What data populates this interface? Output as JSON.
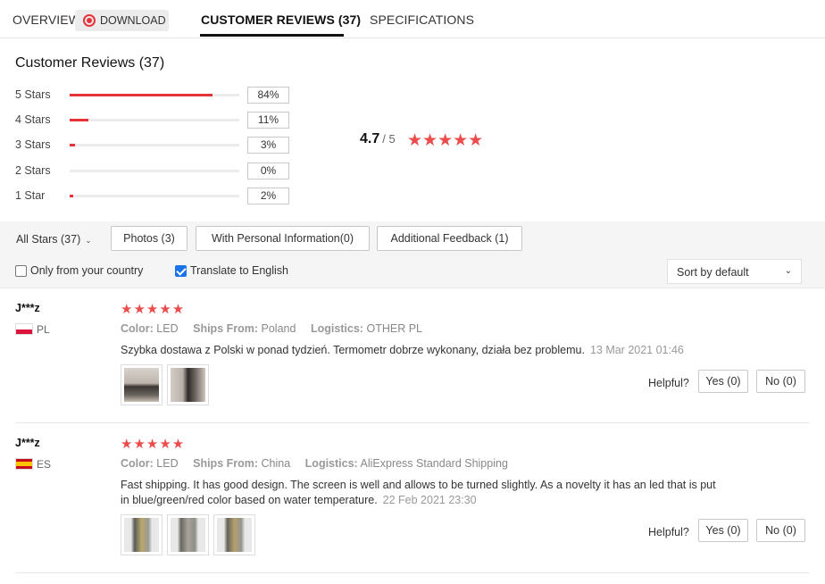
{
  "tabs": {
    "overview": "OVERVIEW",
    "download": "DOWNLOAD",
    "reviews": "CUSTOMER REVIEWS (37)",
    "specs": "SPECIFICATIONS"
  },
  "summary": {
    "title": "Customer Reviews (37)",
    "rows": [
      {
        "label": "5 Stars",
        "pct": "84%",
        "fill": 0.84
      },
      {
        "label": "4 Stars",
        "pct": "11%",
        "fill": 0.11
      },
      {
        "label": "3 Stars",
        "pct": "3%",
        "fill": 0.03
      },
      {
        "label": "2 Stars",
        "pct": "0%",
        "fill": 0.0
      },
      {
        "label": "1 Star",
        "pct": "2%",
        "fill": 0.02
      }
    ],
    "average": "4.7",
    "out_of": "/ 5",
    "stars": "★★★★★"
  },
  "filters": {
    "all_stars": "All Stars (37)",
    "photos": "Photos (3)",
    "personal": "With Personal Information(0)",
    "additional": "Additional Feedback (1)",
    "only_country": "Only from your country",
    "only_country_checked": false,
    "translate": "Translate to English",
    "translate_checked": true,
    "sort": "Sort by default"
  },
  "colors": {
    "accent_red": "#e6323b",
    "star_red": "#ec4c4c",
    "checkbox_blue": "#1a73e8"
  },
  "reviews": [
    {
      "name": "J***z",
      "country": "PL",
      "stars": "★★★★★",
      "color_key": "Color:",
      "color_val": "LED",
      "ships_key": "Ships From:",
      "ships_val": "Poland",
      "logistics_key": "Logistics:",
      "logistics_val": "OTHER PL",
      "text": "Szybka dostawa z Polski w ponad tydzień. Termometr dobrze wykonany, działa bez problemu.",
      "date": "13 Mar 2021 01:46",
      "helpful": "Helpful?",
      "yes": "Yes (0)",
      "no": "No (0)"
    },
    {
      "name": "J***z",
      "country": "ES",
      "stars": "★★★★★",
      "color_key": "Color:",
      "color_val": "LED",
      "ships_key": "Ships From:",
      "ships_val": "China",
      "logistics_key": "Logistics:",
      "logistics_val": "AliExpress Standard Shipping",
      "text": "Fast shipping. It has good design. The screen is well and allows to be turned slightly. As a novelty it has an led that is put in blue/green/red color based on water temperature.",
      "date": "22 Feb 2021 23:30",
      "helpful": "Helpful?",
      "yes": "Yes (0)",
      "no": "No (0)"
    }
  ]
}
